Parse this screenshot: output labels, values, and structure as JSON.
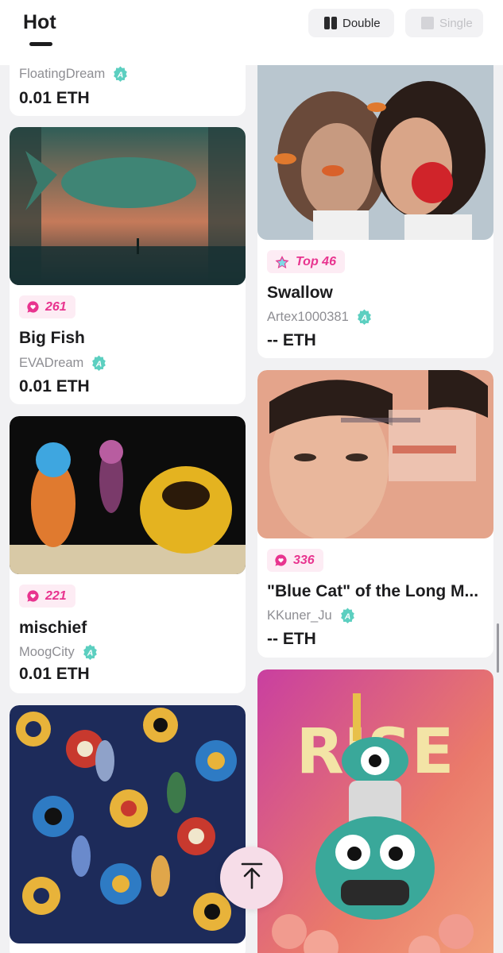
{
  "header": {
    "title": "Hot",
    "view_double_label": "Double",
    "view_single_label": "Single"
  },
  "colors": {
    "accent_pink": "#e8348f",
    "verified_teal": "#5ccfc0"
  },
  "cards": [
    {
      "creator": "FloatingDream",
      "price": "0.01 ETH"
    },
    {
      "badge": "261",
      "badge_icon": "heart-chat-icon",
      "name": "Big Fish",
      "creator": "EVADream",
      "price": "0.01 ETH"
    },
    {
      "badge": "221",
      "badge_icon": "heart-chat-icon",
      "name": "mischief",
      "creator": "MoogCity",
      "price": "0.01 ETH"
    },
    {
      "badge": "Top 46",
      "badge_icon": "star-icon",
      "name": "Swallow",
      "creator": "Artex1000381",
      "price": "-- ETH"
    },
    {
      "badge": "336",
      "badge_icon": "heart-chat-icon",
      "name": "\"Blue Cat\" of the Long M...",
      "creator": "KKuner_Ju",
      "price": "-- ETH"
    }
  ]
}
